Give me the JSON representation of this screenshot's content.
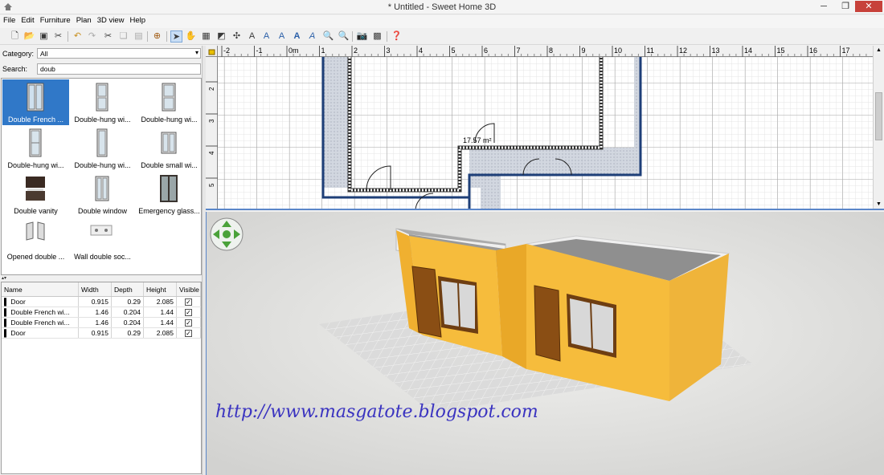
{
  "window": {
    "title": "* Untitled - Sweet Home 3D",
    "close_glyph": "✕",
    "minimize_glyph": "─",
    "restore_glyph": "❐"
  },
  "menu": [
    "File",
    "Edit",
    "Furniture",
    "Plan",
    "3D view",
    "Help"
  ],
  "toolbar": {
    "icons": [
      "new-home-icon",
      "open-icon",
      "save-icon",
      "preferences-icon",
      "undo-icon",
      "redo-icon",
      "cut-icon",
      "copy-icon",
      "paste-icon",
      "add-furniture-icon",
      "select-icon",
      "pan-icon",
      "create-walls-icon",
      "create-rooms-icon",
      "create-dimensions-icon",
      "add-text-icon",
      "text-style-icon",
      "text-style-icon",
      "text-style-icon",
      "text-style-icon",
      "zoom-in-icon",
      "zoom-out-icon",
      "create-photo-icon",
      "create-video-icon",
      "help-icon"
    ],
    "selected": "select-icon"
  },
  "catalog": {
    "category_label": "Category:",
    "category_value": "All",
    "search_label": "Search:",
    "search_value": "doub",
    "items": [
      {
        "label": "Double French ...",
        "icon": "french-window-icon",
        "selected": true
      },
      {
        "label": "Double-hung wi...",
        "icon": "window-icon"
      },
      {
        "label": "Double-hung wi...",
        "icon": "window-icon"
      },
      {
        "label": "Double-hung wi...",
        "icon": "window-icon"
      },
      {
        "label": "Double-hung wi...",
        "icon": "window-icon"
      },
      {
        "label": "Double small wi...",
        "icon": "window-icon"
      },
      {
        "label": "Double vanity",
        "icon": "vanity-icon"
      },
      {
        "label": "Double window",
        "icon": "window-icon"
      },
      {
        "label": "Emergency glass...",
        "icon": "glass-door-icon"
      },
      {
        "label": "Opened double ...",
        "icon": "door-icon"
      },
      {
        "label": "Wall double soc...",
        "icon": "socket-icon"
      }
    ]
  },
  "furniture_table": {
    "columns": [
      "Name",
      "Width",
      "Depth",
      "Height",
      "Visible"
    ],
    "rows": [
      {
        "name": "Door",
        "width": "0.915",
        "depth": "0.29",
        "height": "2.085",
        "visible": "✓"
      },
      {
        "name": "Double French wi...",
        "width": "1.46",
        "depth": "0.204",
        "height": "1.44",
        "visible": "✓"
      },
      {
        "name": "Double French wi...",
        "width": "1.46",
        "depth": "0.204",
        "height": "1.44",
        "visible": "✓"
      },
      {
        "name": "Door",
        "width": "0.915",
        "depth": "0.29",
        "height": "2.085",
        "visible": "✓"
      }
    ]
  },
  "plan": {
    "ruler_x": [
      "-2",
      "-1",
      "0m",
      "1",
      "2",
      "3",
      "4",
      "5",
      "6",
      "7",
      "8",
      "9",
      "10",
      "11",
      "12",
      "13",
      "14",
      "15",
      "16",
      "17"
    ],
    "ruler_y": [
      "2",
      "3",
      "4",
      "5"
    ],
    "room_area": "17.57 m²"
  },
  "view3d": {
    "navigation_icon": "navigation-arrows-icon",
    "watermark": "http://www.masgatote.blogspot.com",
    "wall_color": "#f4b940"
  }
}
